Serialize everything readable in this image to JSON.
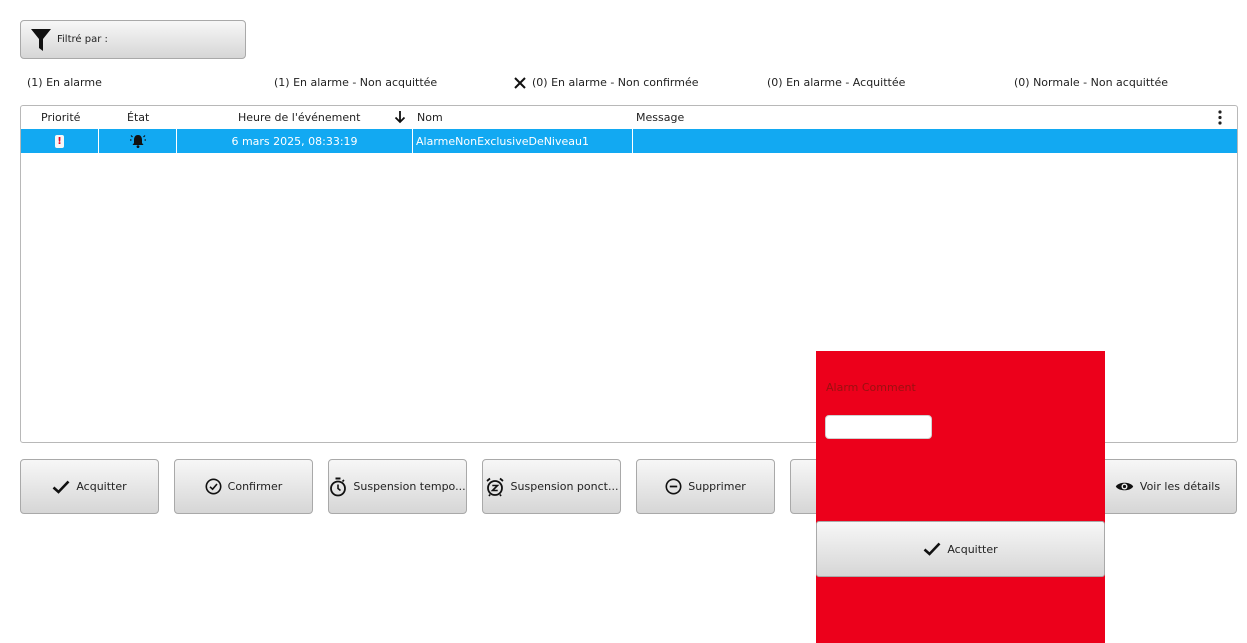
{
  "filter": {
    "label": "Filtré par :",
    "icon": "funnel-icon"
  },
  "summary": [
    {
      "label": "(1) En alarme"
    },
    {
      "label": "(1) En alarme - Non acquittée"
    },
    {
      "label": "(0) En alarme - Non confirmée",
      "icon": "close-x-icon"
    },
    {
      "label": "(0) En alarme - Acquittée"
    },
    {
      "label": "(0) Normale - Non acquittée"
    }
  ],
  "table": {
    "columns": {
      "priority": "Priorité",
      "state": "État",
      "event_time": "Heure de l'événement",
      "name": "Nom",
      "message": "Message"
    },
    "sort": {
      "column": "event_time",
      "direction": "descending",
      "icon": "arrow-down-icon"
    },
    "menu_icon": "more-vertical-icon",
    "rows": [
      {
        "priority_badge": "!",
        "state_icon": "alarm-bell-icon",
        "event_time": "6 mars 2025, 08:33:19",
        "name": "AlarmeNonExclusiveDeNiveau1",
        "message": "",
        "selected": true
      }
    ]
  },
  "actions": {
    "acknowledge": "Acquitter",
    "confirm": "Confirmer",
    "shelve_timed": "Suspension tempo...",
    "shelve_oneshot": "Suspension ponct...",
    "delete": "Supprimer",
    "view_details": "Voir les détails"
  },
  "overlay": {
    "label": "Alarm Comment",
    "comment_value": "",
    "button_label": "Acquitter",
    "background": "#ec001b"
  },
  "colors": {
    "selected_row": "#12a9f2",
    "priority_badge": "#e8001f"
  }
}
